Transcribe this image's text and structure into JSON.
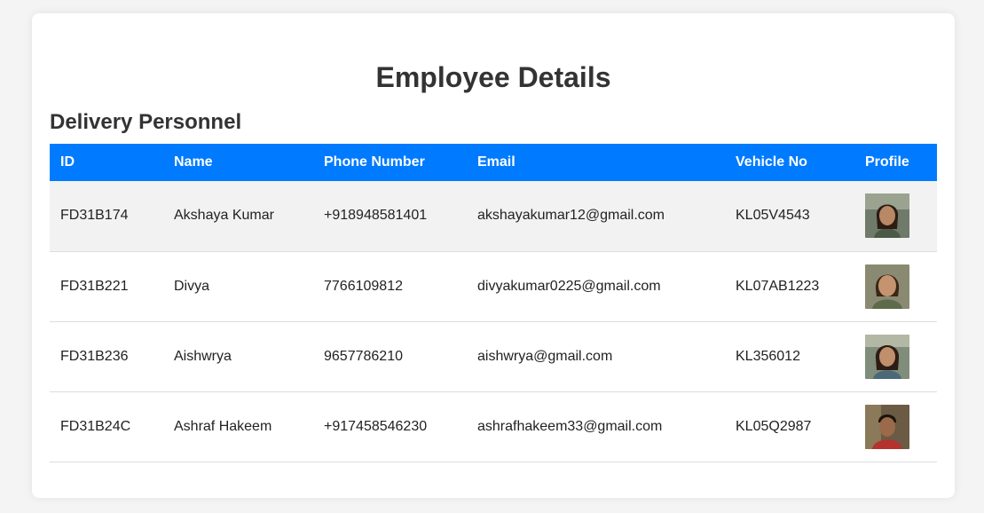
{
  "page": {
    "title": "Employee Details",
    "section_title": "Delivery Personnel"
  },
  "table": {
    "headers": [
      "ID",
      "Name",
      "Phone Number",
      "Email",
      "Vehicle No",
      "Profile"
    ],
    "rows": [
      {
        "id": "FD31B174",
        "name": "Akshaya Kumar",
        "phone": "+918948581401",
        "email": "akshayakumar12@gmail.com",
        "vehicle": "KL05V4543",
        "profile": "avatar-icon"
      },
      {
        "id": "FD31B221",
        "name": "Divya",
        "phone": "7766109812",
        "email": "divyakumar0225@gmail.com",
        "vehicle": "KL07AB1223",
        "profile": "avatar-icon"
      },
      {
        "id": "FD31B236",
        "name": "Aishwrya",
        "phone": "9657786210",
        "email": "aishwrya@gmail.com",
        "vehicle": "KL356012",
        "profile": "avatar-icon"
      },
      {
        "id": "FD31B24C",
        "name": "Ashraf Hakeem",
        "phone": "+917458546230",
        "email": "ashrafhakeem33@gmail.com",
        "vehicle": "KL05Q2987",
        "profile": "avatar-icon"
      }
    ]
  },
  "colors": {
    "header_bg": "#007bff",
    "header_text": "#ffffff",
    "first_row_bg": "#f2f2f2",
    "page_bg": "#f4f4f4"
  }
}
